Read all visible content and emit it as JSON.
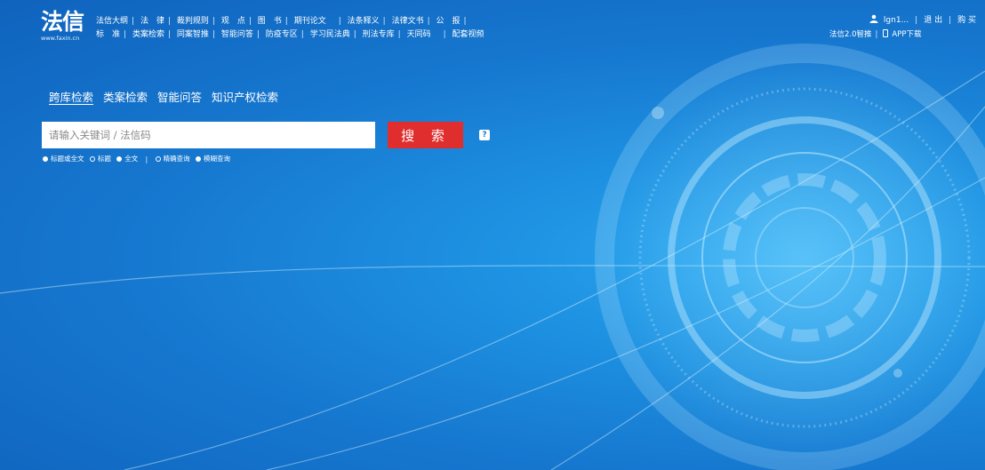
{
  "logo": {
    "main": "法信",
    "sub": "www.faxin.cn"
  },
  "nav": {
    "row1": [
      "法信大纲",
      "法　律",
      "裁判规则",
      "观　点",
      "图　书",
      "期刊论文",
      "法条释义",
      "法律文书",
      "公　报"
    ],
    "row2": [
      "标　准",
      "类案检索",
      "同案智推",
      "智能问答",
      "防疫专区",
      "学习民法典",
      "刑法专库",
      "天同码",
      "配套视频"
    ]
  },
  "user": {
    "name": "lgn1...",
    "logout": "退 出",
    "buy": "购 买"
  },
  "app": {
    "recommend": "法信2.0智推",
    "download": "APP下载"
  },
  "search": {
    "tabs": [
      "跨库检索",
      "类案检索",
      "智能问答",
      "知识产权检索"
    ],
    "active_tab": "跨库检索",
    "placeholder": "请输入关键词 / 法信码",
    "value": "",
    "button": "搜 索",
    "help": "?"
  },
  "options": {
    "scope": [
      {
        "label": "标题或全文",
        "checked": true
      },
      {
        "label": "标题",
        "checked": false
      },
      {
        "label": "全文",
        "checked": true
      }
    ],
    "mode": [
      {
        "label": "精确查询",
        "checked": false
      },
      {
        "label": "模糊查询",
        "checked": true
      }
    ]
  },
  "colors": {
    "accent": "#e02e2e",
    "background": "#1a84d8",
    "text": "#ffffff"
  },
  "icons": {
    "user": "user-icon",
    "phone": "phone-icon",
    "help": "question-icon"
  }
}
